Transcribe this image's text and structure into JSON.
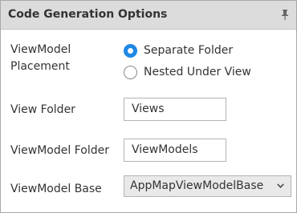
{
  "panel": {
    "title": "Code Generation Options",
    "pin_icon": "pin-icon"
  },
  "placement": {
    "label_line1": "ViewModel",
    "label_line2": "Placement",
    "options": [
      {
        "label": "Separate Folder",
        "selected": true
      },
      {
        "label": "Nested Under View",
        "selected": false
      }
    ]
  },
  "view_folder": {
    "label": "View Folder",
    "value": "Views"
  },
  "viewmodel_folder": {
    "label": "ViewModel Folder",
    "value": "ViewModels"
  },
  "viewmodel_base": {
    "label": "ViewModel Base",
    "selected": "AppMapViewModelBase",
    "icon": "chevron-down-icon"
  },
  "colors": {
    "accent": "#1e88e5",
    "header_bg": "#dcdcdc",
    "border": "#a8a8a8"
  }
}
